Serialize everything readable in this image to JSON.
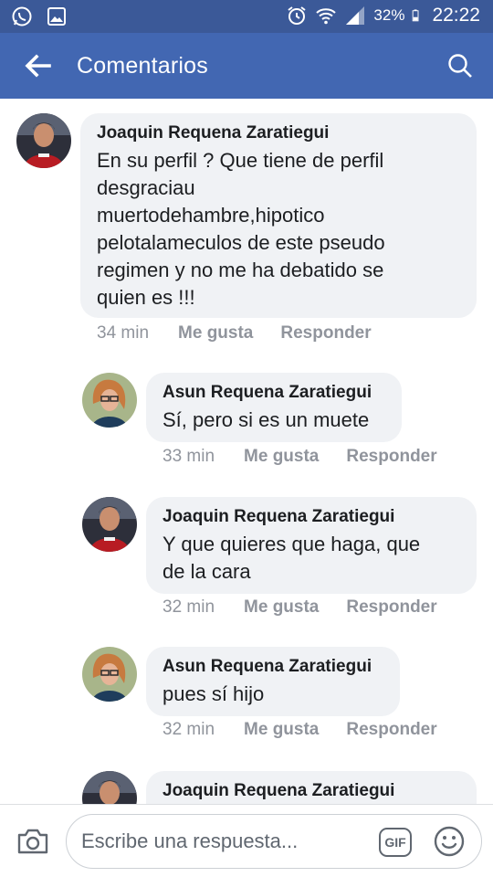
{
  "status_bar": {
    "battery_percent": "32%",
    "time": "22:22",
    "icons": [
      "whatsapp-icon",
      "gallery-icon",
      "alarm-icon",
      "wifi-icon",
      "signal-icon",
      "battery-icon"
    ]
  },
  "header": {
    "title": "Comentarios",
    "colors": {
      "app_bar": "#4267b2",
      "status_bar": "#3b5998"
    }
  },
  "comments": [
    {
      "author": "Joaquin Requena Zaratiegui",
      "lines": [
        "En su perfil ? Que tiene de perfil",
        "desgraciau",
        "muertodehambre,hipotico",
        "pelotalameculos de este pseudo",
        "regimen y no me ha debatido se",
        "quien es !!!"
      ],
      "time": "34 min",
      "like": "Me gusta",
      "reply": "Responder"
    },
    {
      "author": "Asun Requena Zaratiegui",
      "lines": [
        "Sí, pero si es un muete"
      ],
      "time": "33 min",
      "like": "Me gusta",
      "reply": "Responder"
    },
    {
      "author": "Joaquin Requena Zaratiegui",
      "lines": [
        "Y que quieres que haga, que",
        "de la cara"
      ],
      "time": "32 min",
      "like": "Me gusta",
      "reply": "Responder"
    },
    {
      "author": "Asun Requena Zaratiegui",
      "lines": [
        "pues sí hijo"
      ],
      "time": "32 min",
      "like": "Me gusta",
      "reply": "Responder"
    },
    {
      "author": "Joaquin Requena Zaratiegui"
    }
  ],
  "composer": {
    "placeholder": "Escribe una respuesta...",
    "gif_label": "GIF"
  }
}
